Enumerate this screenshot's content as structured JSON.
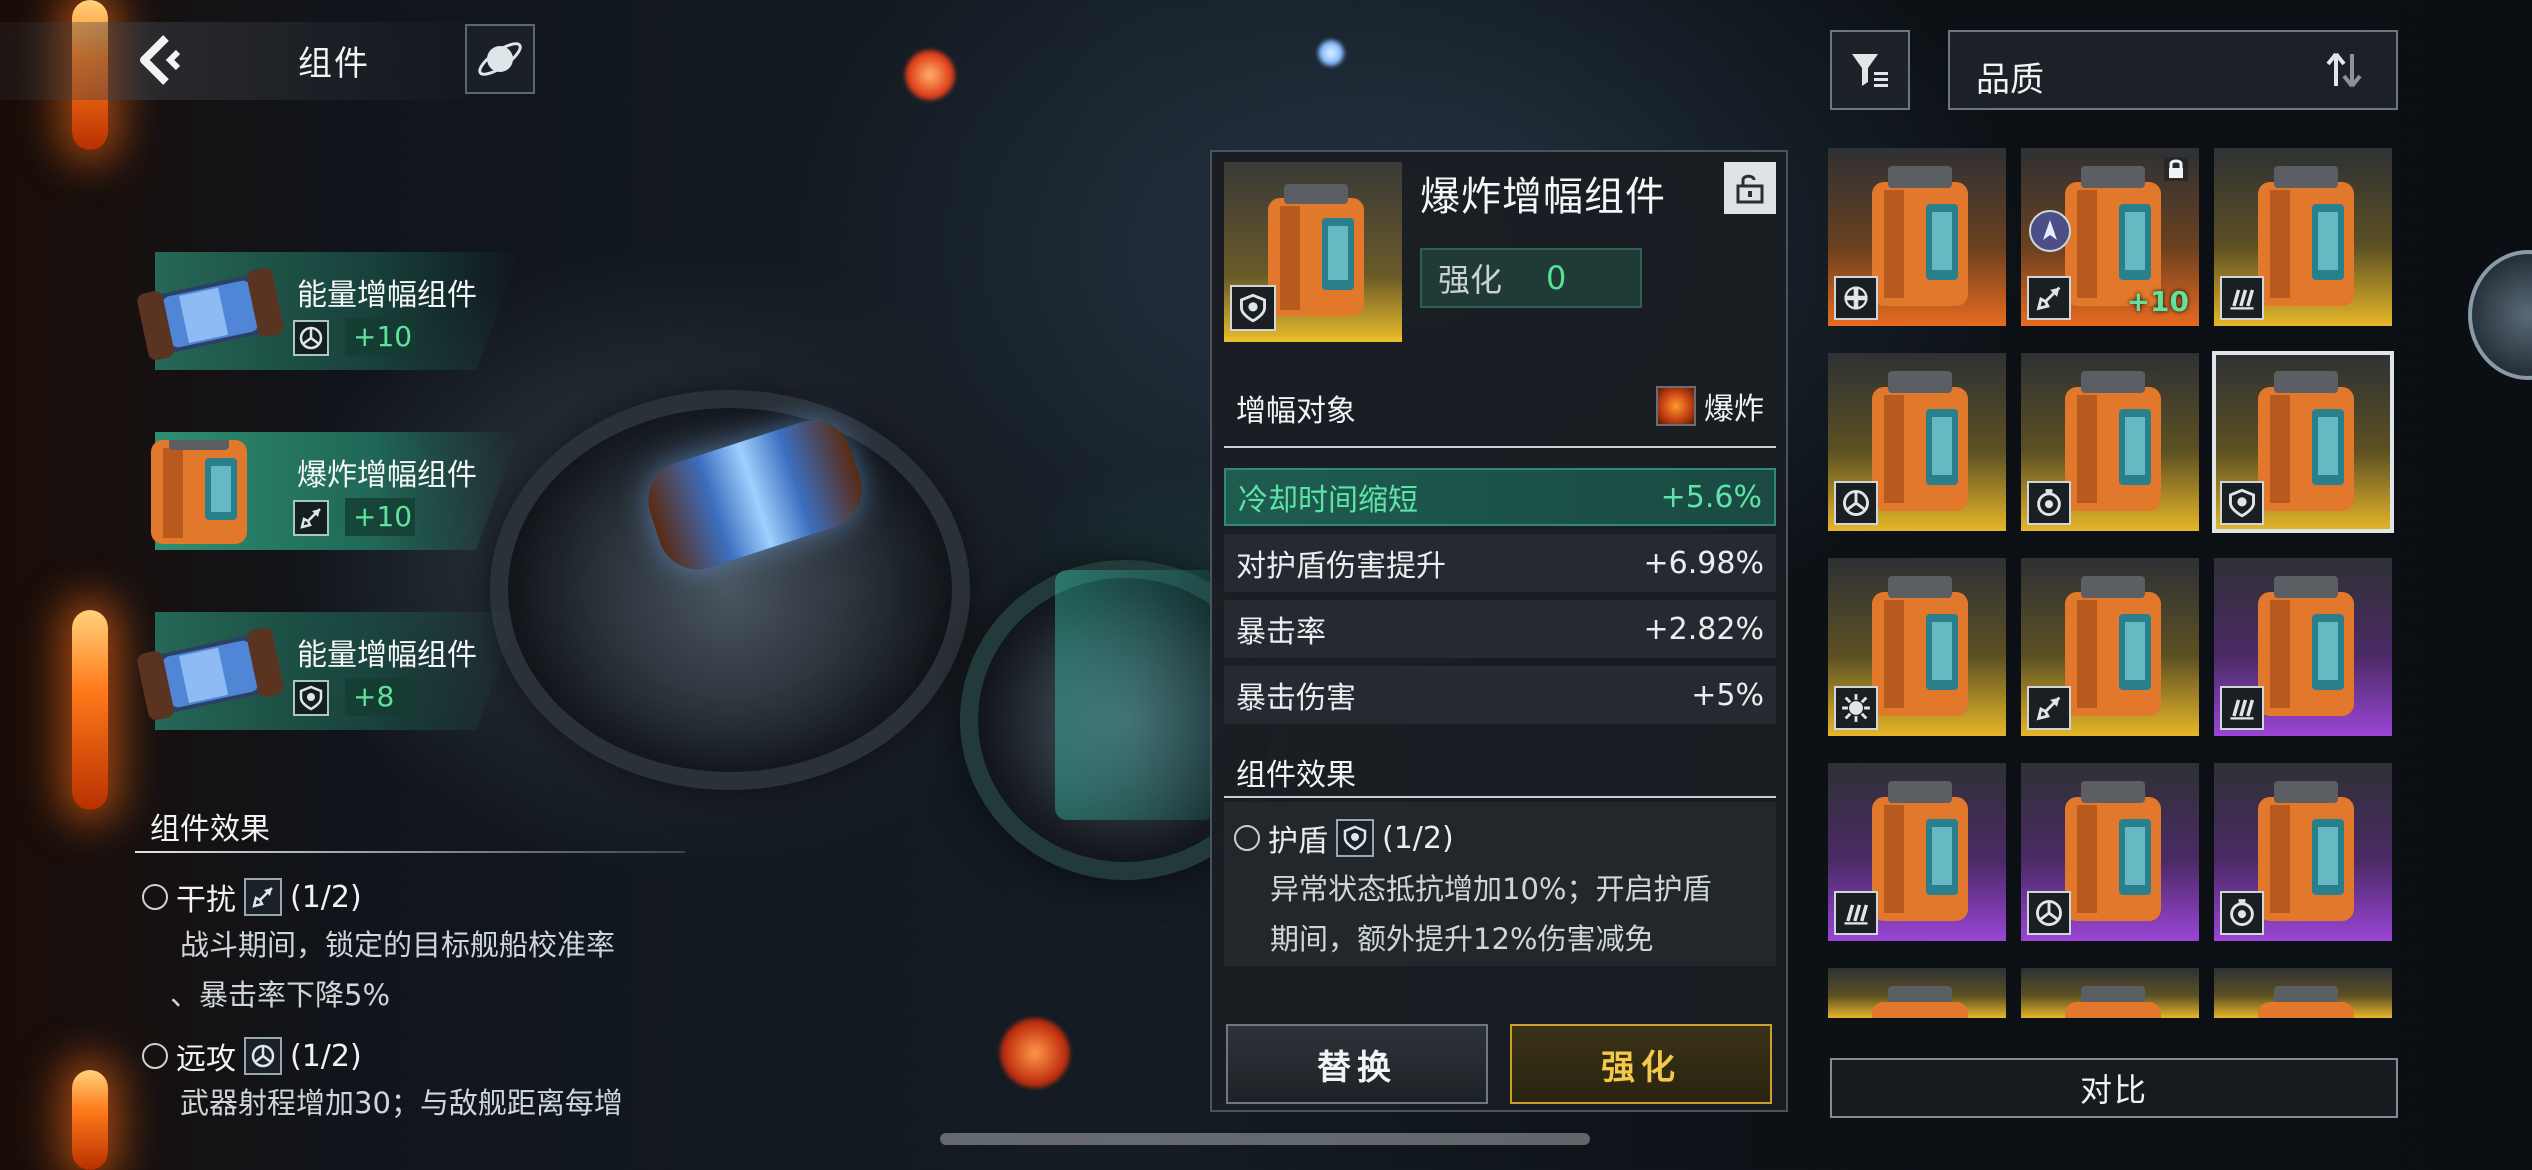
{
  "header": {
    "title": "组件"
  },
  "equipped": [
    {
      "name": "能量增幅组件",
      "level": "+10",
      "icon": "target-icon",
      "kind": "energy",
      "active": false
    },
    {
      "name": "爆炸增幅组件",
      "level": "+10",
      "icon": "rocket-icon",
      "kind": "explosive",
      "active": true
    },
    {
      "name": "能量增幅组件",
      "level": "+8",
      "icon": "shield-skull-icon",
      "kind": "energy",
      "active": false
    }
  ],
  "set_effects": {
    "title": "组件效果",
    "items": [
      {
        "name": "干扰",
        "icon": "rocket-icon",
        "progress": "(1/2)",
        "desc_lines": [
          "战斗期间，锁定的目标舰船校准率",
          "、暴击率下降5%"
        ]
      },
      {
        "name": "远攻",
        "icon": "target-icon",
        "progress": "(1/2)",
        "desc_lines": [
          "武器射程增加30；与敌舰距离每增"
        ]
      }
    ]
  },
  "detail": {
    "name": "爆炸增幅组件",
    "enhance_label": "强化",
    "enhance_value": "0",
    "target_label": "增幅对象",
    "target_value": "爆炸",
    "stats": [
      {
        "label": "冷却时间缩短",
        "value": "+5.6%",
        "highlight": true
      },
      {
        "label": "对护盾伤害提升",
        "value": "+6.98%",
        "highlight": false
      },
      {
        "label": "暴击率",
        "value": "+2.82%",
        "highlight": false
      },
      {
        "label": "暴击伤害",
        "value": "+5%",
        "highlight": false
      }
    ],
    "component_effect_title": "组件效果",
    "effect": {
      "name": "护盾",
      "progress": "(1/2)",
      "desc_lines": [
        "异常状态抵抗增加10%；开启护盾",
        "期间，额外提升12%伤害减免"
      ]
    },
    "buttons": {
      "replace": "替换",
      "enhance": "强化"
    }
  },
  "sort": {
    "label": "品质"
  },
  "inventory": [
    {
      "rarity": "orange",
      "icon": "cross-icon",
      "level": "",
      "locked": false
    },
    {
      "rarity": "orange",
      "icon": "rocket-icon",
      "level": "+10",
      "locked": true,
      "equipped_mark": true
    },
    {
      "rarity": "gold",
      "icon": "bars-icon",
      "level": "",
      "locked": false
    },
    {
      "rarity": "gold",
      "icon": "target-icon",
      "level": "",
      "locked": false
    },
    {
      "rarity": "gold",
      "icon": "timer-skull-icon",
      "level": "",
      "locked": false
    },
    {
      "rarity": "gold",
      "icon": "shield-skull-icon",
      "level": "",
      "locked": false,
      "selected": true
    },
    {
      "rarity": "gold",
      "icon": "gear-burst-icon",
      "level": "",
      "locked": false
    },
    {
      "rarity": "gold",
      "icon": "rocket-icon",
      "level": "",
      "locked": false
    },
    {
      "rarity": "purple",
      "icon": "bars-icon",
      "level": "",
      "locked": false
    },
    {
      "rarity": "purple",
      "icon": "bars-icon",
      "level": "",
      "locked": false
    },
    {
      "rarity": "purple",
      "icon": "target-icon",
      "level": "",
      "locked": false
    },
    {
      "rarity": "purple",
      "icon": "timer-skull-icon",
      "level": "",
      "locked": false
    }
  ],
  "compare_label": "对比"
}
